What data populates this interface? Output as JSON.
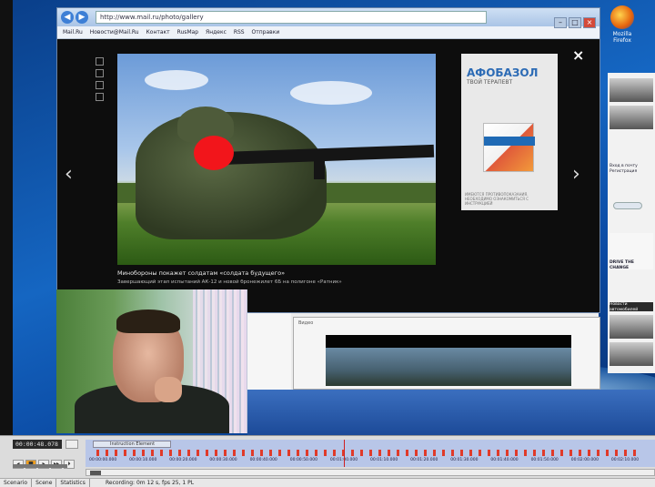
{
  "browser": {
    "address": "http://www.mail.ru/photo/gallery",
    "bookmarks": [
      "Mail.Ru",
      "Новости@Mail.Ru",
      "Контакт",
      "RusMap",
      "Яндекс",
      "RSS",
      "Отправки"
    ],
    "window_controls": [
      "–",
      "□",
      "×"
    ]
  },
  "desktop_icon": {
    "label": "Mozilla Firefox"
  },
  "lightbox": {
    "close": "×",
    "prev": "‹",
    "next": "›",
    "caption_title": "Минобороны покажет солдатам «солдата будущего»",
    "caption_sub": "Завершающий этап испытаний АК-12 и новой бронежилет 6Б на полигоне «Ратник»"
  },
  "ad": {
    "brand": "АФОБАЗОЛ",
    "slogan": "ТВОЙ ТЕРАПЕВТ",
    "fine_print": "ИМЕЮТСЯ ПРОТИВОПОКАЗАНИЯ. НЕОБХОДИМО ОЗНАКОМИТЬСЯ С ИНСТРУКЦИЕЙ"
  },
  "rightcol": {
    "items": [
      "Вход в почту",
      "Регистрация",
      "DRIVE THE CHANGE",
      "Новости автомобилей"
    ]
  },
  "inner_page": {
    "title": "Видео"
  },
  "recorder": {
    "time": "00:00:48.078",
    "transport": [
      "◂",
      "■",
      "▸",
      "▸▸",
      "⏵"
    ],
    "tab_label": "Instruction Element",
    "ticks": [
      "00:00:00.000",
      "00:00:10.000",
      "00:00:20.000",
      "00:00:30.000",
      "00:00:40.000",
      "00:00:50.000",
      "00:01:00.000",
      "00:01:10.000",
      "00:01:20.000",
      "00:01:30.000",
      "00:01:40.000",
      "00:01:50.000",
      "00:02:00.000",
      "00:02:10.000"
    ],
    "status_tabs": [
      "Scenario",
      "Scene",
      "Statistics"
    ],
    "status_msg": "Recording: 0m 12 s, fps 25, 1 PL"
  }
}
